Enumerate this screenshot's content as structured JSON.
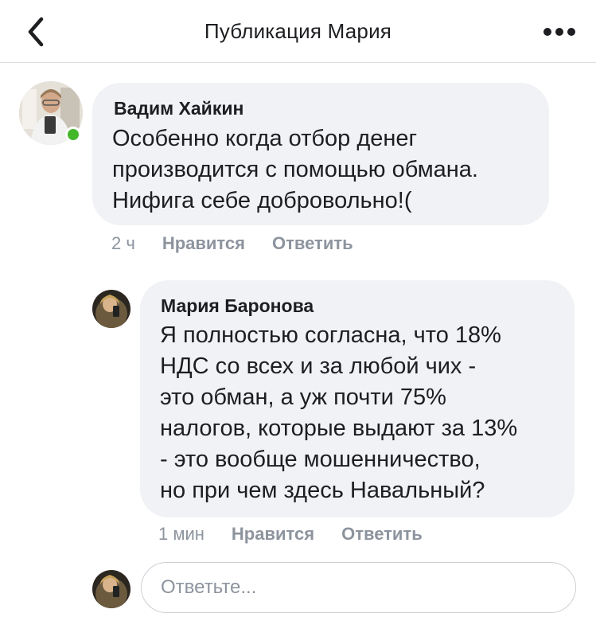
{
  "header": {
    "title": "Публикация Мария",
    "back_icon": "chevron-left-icon",
    "more_icon": "more-horizontal-icon"
  },
  "comments": [
    {
      "author": "Вадим Хайкин",
      "text": "Особенно когда отбор денег\nпроизводится с помощью обмана.\nНифига себе добровольно!(",
      "time": "2 ч",
      "like_label": "Нравится",
      "reply_label": "Ответить",
      "online": true
    },
    {
      "author": "Мария Баронова",
      "text": "Я полностью согласна, что 18%\nНДС со всех и за любой чих -\nэто обман, а уж почти 75%\nналогов, которые выдают за 13%\n- это вообще мошенничество,\nно при чем здесь Навальный?",
      "time": "1 мин",
      "like_label": "Нравится",
      "reply_label": "Ответить"
    }
  ],
  "reply_box": {
    "placeholder": "Ответьте..."
  },
  "colors": {
    "bubble": "#f0f2f5",
    "meta_text": "#8d949e",
    "online": "#42b72a",
    "divider": "#dadde1"
  }
}
